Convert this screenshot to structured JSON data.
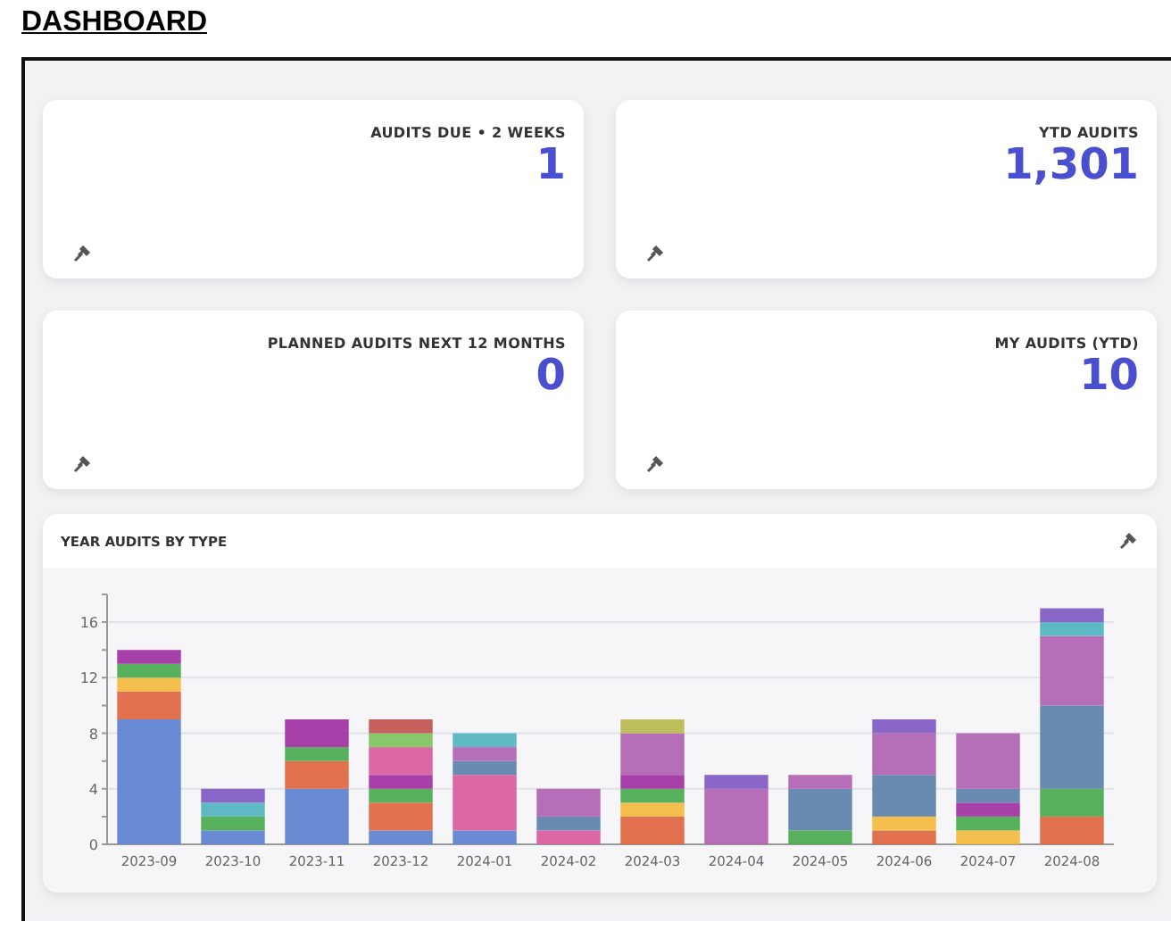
{
  "title": "DASHBOARD",
  "cards": [
    {
      "label": "AUDITS DUE • 2 WEEKS",
      "value": "1"
    },
    {
      "label": "YTD AUDITS",
      "value": "1,301"
    },
    {
      "label": "PLANNED AUDITS NEXT 12 MONTHS",
      "value": "0"
    },
    {
      "label": "MY AUDITS (YTD)",
      "value": "10"
    }
  ],
  "chart_panel": {
    "title": "YEAR AUDITS BY TYPE",
    "chart_data": {
      "type": "bar",
      "stacked": true,
      "categories": [
        "2023-09",
        "2023-10",
        "2023-11",
        "2023-12",
        "2024-01",
        "2024-02",
        "2024-03",
        "2024-04",
        "2024-05",
        "2024-06",
        "2024-07",
        "2024-08"
      ],
      "ylim": [
        0,
        18
      ],
      "grid": true,
      "yticks": [
        0,
        4,
        8,
        12,
        16
      ],
      "series": [
        {
          "color": "#5b7fcf",
          "values": [
            9,
            1,
            4,
            1,
            1,
            0,
            0,
            0,
            0,
            0,
            0,
            0
          ]
        },
        {
          "color": "#e0643c",
          "values": [
            2,
            0,
            2,
            2,
            0,
            0,
            2,
            0,
            0,
            1,
            0,
            2
          ]
        },
        {
          "color": "#f5b93a",
          "values": [
            1,
            0,
            0,
            0,
            0,
            0,
            1,
            0,
            0,
            1,
            1,
            0
          ]
        },
        {
          "color": "#46a84a",
          "values": [
            1,
            1,
            1,
            1,
            0,
            0,
            1,
            0,
            1,
            0,
            1,
            2
          ]
        },
        {
          "color": "#a02ca0",
          "values": [
            1,
            0,
            2,
            1,
            0,
            0,
            1,
            0,
            0,
            0,
            1,
            0
          ]
        },
        {
          "color": "#d9589a",
          "values": [
            0,
            0,
            0,
            2,
            4,
            1,
            0,
            0,
            0,
            0,
            0,
            0
          ]
        },
        {
          "color": "#7cc25a",
          "values": [
            0,
            0,
            0,
            1,
            0,
            0,
            0,
            0,
            0,
            0,
            0,
            0
          ]
        },
        {
          "color": "#c0504d",
          "values": [
            0,
            0,
            0,
            1,
            0,
            0,
            0,
            0,
            0,
            0,
            0,
            0
          ]
        },
        {
          "color": "#5a7fa8",
          "values": [
            0,
            0,
            0,
            0,
            1,
            1,
            0,
            0,
            3,
            3,
            1,
            6
          ]
        },
        {
          "color": "#b05fb0",
          "values": [
            0,
            0,
            0,
            0,
            1,
            2,
            3,
            4,
            1,
            3,
            4,
            5
          ]
        },
        {
          "color": "#4fb3bf",
          "values": [
            0,
            1,
            0,
            0,
            1,
            0,
            0,
            0,
            0,
            0,
            0,
            1
          ]
        },
        {
          "color": "#7e57c2",
          "values": [
            0,
            1,
            0,
            0,
            0,
            0,
            0,
            1,
            0,
            1,
            0,
            1
          ]
        },
        {
          "color": "#b8b84a",
          "values": [
            0,
            0,
            0,
            0,
            0,
            0,
            1,
            0,
            0,
            0,
            0,
            0
          ]
        }
      ]
    }
  }
}
